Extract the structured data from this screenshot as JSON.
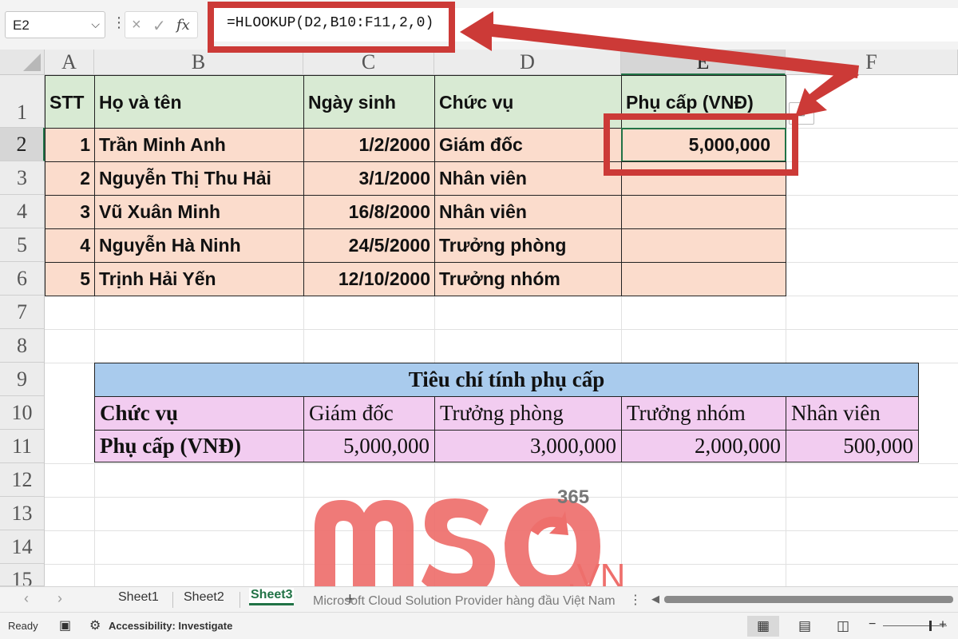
{
  "formula_bar": {
    "name_box": "E2",
    "name_box_chevron": "chevron-down-icon",
    "more_icon": "vertical-dots-icon",
    "cancel_icon": "×",
    "enter_icon": "✓",
    "fx_label": "fx",
    "formula": "=HLOOKUP(D2,B10:F11,2,0)"
  },
  "columns": [
    "A",
    "B",
    "C",
    "D",
    "E",
    "F"
  ],
  "selected_column": "E",
  "rows": [
    "1",
    "2",
    "3",
    "4",
    "5",
    "6",
    "7",
    "8",
    "9",
    "10",
    "11",
    "12",
    "13",
    "14",
    "15"
  ],
  "selected_row": "2",
  "employee_table": {
    "headers": [
      "STT",
      "Họ và tên",
      "Ngày sinh",
      "Chức vụ",
      "Phụ cấp (VNĐ)"
    ],
    "rows": [
      [
        "1",
        "Trần Minh Anh",
        "1/2/2000",
        "Giám đốc",
        "5,000,000"
      ],
      [
        "2",
        "Nguyễn Thị Thu Hải",
        "3/1/2000",
        "Nhân viên",
        ""
      ],
      [
        "3",
        "Vũ Xuân Minh",
        "16/8/2000",
        "Nhân viên",
        ""
      ],
      [
        "4",
        "Nguyễn Hà Ninh",
        "24/5/2000",
        "Trưởng phòng",
        ""
      ],
      [
        "5",
        "Trịnh Hải Yến",
        "12/10/2000",
        "Trưởng nhóm",
        ""
      ]
    ]
  },
  "criteria_table": {
    "title": "Tiêu chí tính phụ cấp",
    "row_labels": [
      "Chức vụ",
      "Phụ cấp (VNĐ)"
    ],
    "positions": [
      "Giám đốc",
      "Trưởng phòng",
      "Trưởng nhóm",
      "Nhân viên"
    ],
    "allowances": [
      "5,000,000",
      "3,000,000",
      "2,000,000",
      "500,000"
    ]
  },
  "watermark": {
    "logo_text": "MSO",
    "superscript": "365",
    "suffix": ".VN",
    "color": "#ee6f6c"
  },
  "sheet_tabs": {
    "tabs": [
      "Sheet1",
      "Sheet2",
      "Sheet3"
    ],
    "active": "Sheet3",
    "add_icon": "+",
    "caption": "Microsoft Cloud Solution Provider hàng đầu Việt Nam",
    "prev_icon": "‹",
    "next_icon": "›"
  },
  "status_bar": {
    "ready": "Ready",
    "accessibility": "Accessibility: Investigate",
    "macro_icon": "macro-recorder-icon",
    "zoom_minus": "−",
    "zoom_plus": "+"
  },
  "colors": {
    "header_fill": "#d8ead3",
    "body_fill": "#fbdccc",
    "criteria_title_fill": "#a9cbed",
    "criteria_fill": "#f2ccf0",
    "annotation_red": "#cc3a37",
    "excel_green": "#217346"
  }
}
